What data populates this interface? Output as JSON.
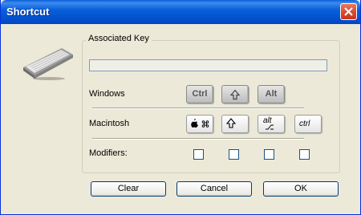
{
  "window": {
    "title": "Shortcut"
  },
  "group": {
    "legend": "Associated Key",
    "key_value": ""
  },
  "rows": {
    "windows": "Windows",
    "macintosh": "Macintosh",
    "modifiers": "Modifiers:"
  },
  "windows_keys": {
    "ctrl": "Ctrl",
    "shift_icon": "shift-arrow-icon",
    "alt": "Alt"
  },
  "mac_keys": {
    "cmd_icons": "apple-command-icon",
    "shift_icon": "shift-arrow-icon",
    "option_label": "alt",
    "ctrl": "ctrl"
  },
  "modifiers": {
    "checked": [
      false,
      false,
      false,
      false
    ]
  },
  "buttons": {
    "clear": "Clear",
    "cancel": "Cancel",
    "ok": "OK"
  }
}
